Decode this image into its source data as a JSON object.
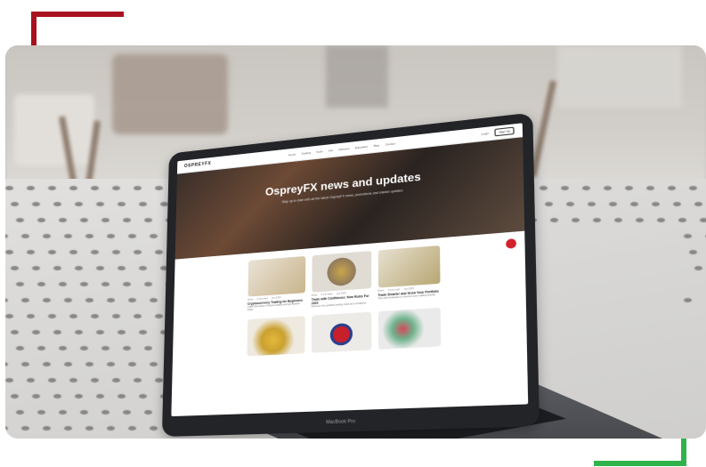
{
  "colors": {
    "accent_red": "#a8121f",
    "accent_green": "#2fb34a",
    "brand_red": "#c0161f"
  },
  "screen": {
    "logo": "OSPREYFX",
    "nav_links": [
      "Home",
      "Trading",
      "Tools",
      "Info",
      "Partners",
      "Education",
      "Blog",
      "Contact"
    ],
    "nav_buttons": [
      "Login",
      "Sign Up"
    ],
    "hero_title": "OspreyFX news and updates",
    "hero_subtitle": "Stay up to date with all the latest OspreyFX news, promotions and market updates",
    "cards": [
      {
        "img": "chess-icon",
        "meta": [
          "News",
          "3 min read",
          "Jun 2023"
        ],
        "title": "Cryptocurrency Trading for Beginners",
        "text": "Learn the basics of crypto trading and get started today."
      },
      {
        "img": "no-sign-icon",
        "meta": [
          "News",
          "5 min read",
          "Jun 2023"
        ],
        "title": "Trade with Confidence: New Rules For 2023",
        "text": "Discover the updated trading rules and conditions."
      },
      {
        "img": "target-icon",
        "meta": [
          "News",
          "4 min read",
          "Jun 2023"
        ],
        "title": "Trade Smarter and Grow Your Portfolio",
        "text": "Tips and strategies to improve your trading results."
      },
      {
        "img": "coins-icon",
        "meta": [],
        "title": "",
        "text": ""
      },
      {
        "img": "flag-globe-icon",
        "meta": [],
        "title": "",
        "text": ""
      },
      {
        "img": "hearts-icon",
        "meta": [],
        "title": "",
        "text": ""
      }
    ],
    "laptop_label": "MacBook Pro"
  }
}
